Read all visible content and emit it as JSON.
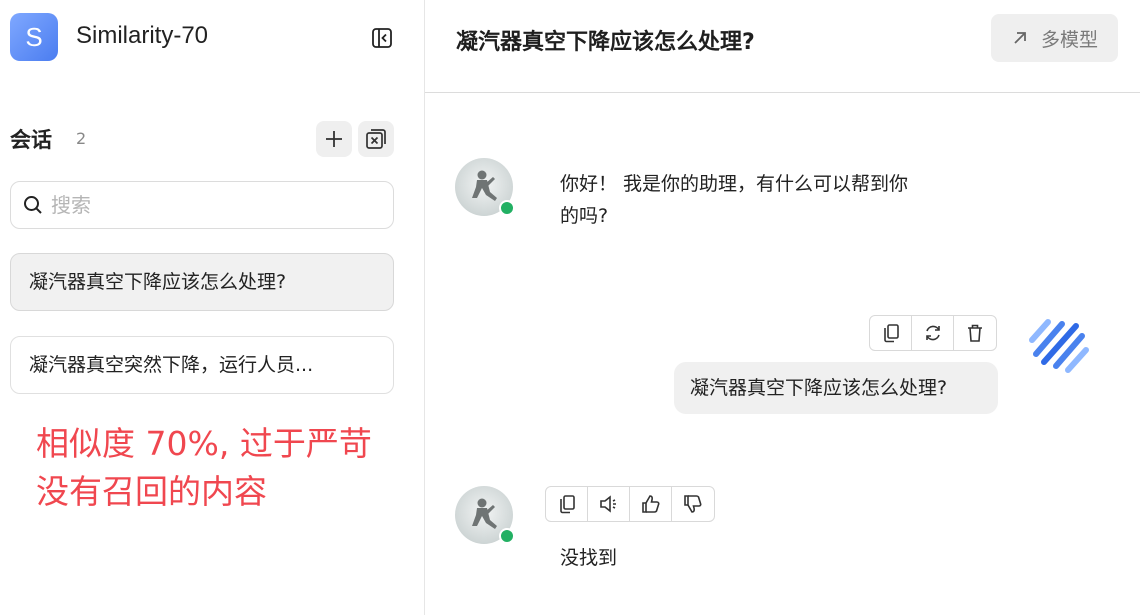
{
  "sidebar": {
    "logo_letter": "S",
    "app_name": "Similarity-70",
    "section_title": "会话",
    "section_count": "2",
    "search_placeholder": "搜索",
    "conversations": [
      {
        "title": "凝汽器真空下降应该怎么处理?"
      },
      {
        "title": "凝汽器真空突然下降，运行人员..."
      }
    ],
    "note_line1": "相似度 70%, 过于严苛",
    "note_line2": "没有召回的内容"
  },
  "header": {
    "title": "凝汽器真空下降应该怎么处理?",
    "multi_model_label": "多模型"
  },
  "messages": {
    "greeting_line1": "你好！ 我是你的助理，有什么可以帮到你",
    "greeting_line2": "的吗?",
    "user_question": "凝汽器真空下降应该怎么处理?",
    "bot_reply": "没找到"
  },
  "colors": {
    "accent": "#4b7df0",
    "online": "#22b063",
    "note": "#f0474f"
  }
}
